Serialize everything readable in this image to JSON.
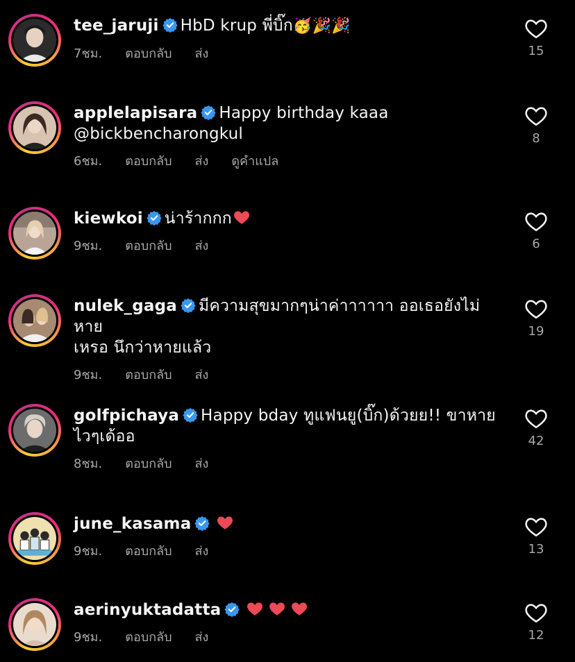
{
  "comments": [
    {
      "username": "tee_jaruji",
      "text": "HbD krup พี่บิ๊ก",
      "emoji": "🥳🎉🎉",
      "time": "7ชม.",
      "reply": "ตอบกลับ",
      "send": "ส่ง",
      "translate": "",
      "likes": "15",
      "avatar_color": "#d9c6b6"
    },
    {
      "username": "applelapisara",
      "text": "Happy birthday kaaa",
      "text2": "@bickbencharongkul",
      "time": "6ชม.",
      "reply": "ตอบกลับ",
      "send": "ส่ง",
      "translate": "ดูคำแปล",
      "likes": "8",
      "avatar_color": "#c9a58f"
    },
    {
      "username": "kiewkoi",
      "text": "น่าร้ากกก",
      "time": "9ชม.",
      "reply": "ตอบกลับ",
      "send": "ส่ง",
      "likes": "6",
      "avatar_color": "#e3c9b3"
    },
    {
      "username": "nulek_gaga",
      "text": "มีความสุขมากๆน่าค่าาาาาา  ออเธอยังไม่หาย",
      "text2": "เหรอ นึกว่าหายแล้ว",
      "time": "9ชม.",
      "reply": "ตอบกลับ",
      "send": "ส่ง",
      "likes": "19",
      "avatar_color": "#b68c6e"
    },
    {
      "username": "golfpichaya",
      "text": "Happy bday ทูแฟนยู(บิ๊ก)ด้วยย!! ขาหาย",
      "text2": "ไวๆเด้ออ",
      "time": "8ชม.",
      "reply": "ตอบกลับ",
      "send": "ส่ง",
      "likes": "42",
      "avatar_color": "#c5b4a8"
    },
    {
      "username": "june_kasama",
      "text": "",
      "time": "9ชม.",
      "reply": "ตอบกลับ",
      "send": "ส่ง",
      "likes": "13",
      "avatar_color": "#e8d9a8"
    },
    {
      "username": "aerinyuktadatta",
      "text": "",
      "time": "9ชม.",
      "reply": "ตอบกลับ",
      "send": "ส่ง",
      "likes": "12",
      "avatar_color": "#d8b89a"
    }
  ],
  "colors": {
    "background": "#000000",
    "text_primary": "#f5f5f5",
    "text_secondary": "#a8a8a8",
    "verified_blue": "#3897f0",
    "red_heart": "#ed4956"
  }
}
